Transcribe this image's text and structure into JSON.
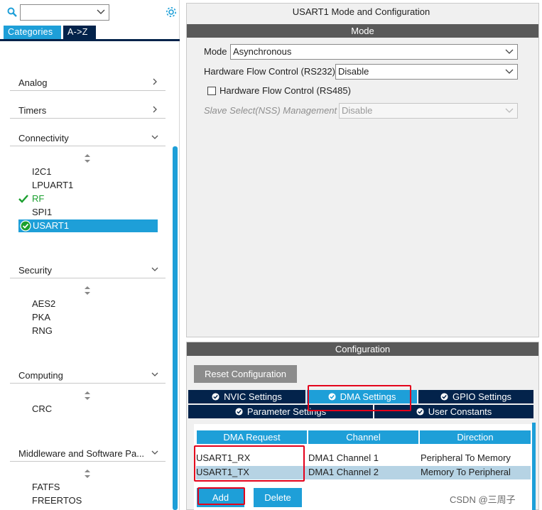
{
  "search": {
    "value": ""
  },
  "left_tabs": {
    "categories": "Categories",
    "az": "A->Z"
  },
  "categories": {
    "analog": "Analog",
    "timers": "Timers",
    "connectivity": {
      "label": "Connectivity",
      "items": [
        "I2C1",
        "LPUART1",
        "RF",
        "SPI1",
        "USART1"
      ]
    },
    "security": {
      "label": "Security",
      "items": [
        "AES2",
        "PKA",
        "RNG"
      ]
    },
    "computing": {
      "label": "Computing",
      "items": [
        "CRC"
      ]
    },
    "middleware": {
      "label": "Middleware and Software Pa...",
      "items": [
        "FATFS",
        "FREERTOS"
      ]
    }
  },
  "config": {
    "title": "USART1 Mode and Configuration",
    "mode_header": "Mode",
    "mode": {
      "label": "Mode",
      "value": "Asynchronous"
    },
    "hw_flow_rs232": {
      "label": "Hardware Flow Control (RS232)",
      "value": "Disable"
    },
    "hw_flow_rs485": {
      "label": "Hardware Flow Control (RS485)",
      "checked": false
    },
    "slave_select": {
      "label": "Slave Select(NSS) Management",
      "value": "Disable"
    },
    "configuration_header": "Configuration",
    "reset_button": "Reset Configuration",
    "tabs": {
      "nvic": "NVIC Settings",
      "dma": "DMA Settings",
      "gpio": "GPIO Settings",
      "parameter": "Parameter Settings",
      "user_constants": "User Constants"
    },
    "dma_table": {
      "headers": [
        "DMA Request",
        "Channel",
        "Direction"
      ],
      "rows": [
        {
          "request": "USART1_RX",
          "channel": "DMA1 Channel 1",
          "direction": "Peripheral To Memory"
        },
        {
          "request": "USART1_TX",
          "channel": "DMA1 Channel 2",
          "direction": "Memory To Peripheral"
        }
      ]
    },
    "add_button": "Add",
    "delete_button": "Delete"
  },
  "watermark": "CSDN @三周子",
  "colors": {
    "accent": "#1e9fd8",
    "dark_navy": "#03234b",
    "section_bar": "#595959",
    "highlight_red": "#e3001b",
    "check_green": "#1a9f2e",
    "selected_row": "#b6d3e4"
  }
}
